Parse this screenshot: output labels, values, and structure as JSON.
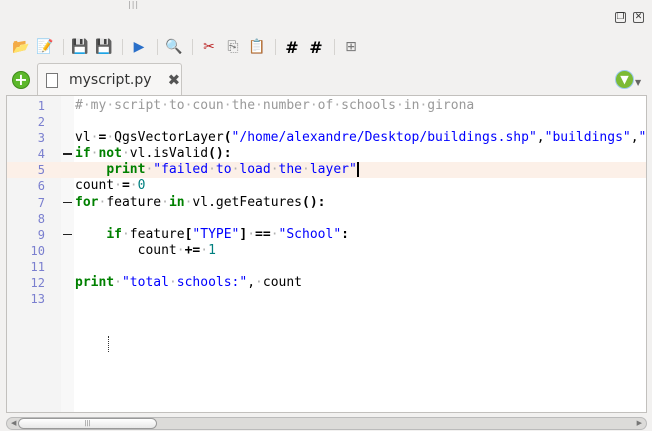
{
  "window": {
    "restore_icon": "restore-icon",
    "close_icon": "close-icon"
  },
  "toolbar": [
    {
      "name": "open-file-icon",
      "glyph": "📂"
    },
    {
      "name": "open-in-external-editor-icon",
      "glyph": "📝"
    },
    {
      "sep": true
    },
    {
      "name": "save-icon",
      "glyph": "💾"
    },
    {
      "name": "save-as-icon",
      "glyph": "💾"
    },
    {
      "sep": true
    },
    {
      "name": "run-script-icon",
      "glyph": "▶"
    },
    {
      "sep": true
    },
    {
      "name": "find-icon",
      "glyph": "🔍"
    },
    {
      "sep": true
    },
    {
      "name": "cut-icon",
      "glyph": "✂"
    },
    {
      "name": "copy-icon",
      "glyph": "⎘"
    },
    {
      "name": "paste-icon",
      "glyph": "📋"
    },
    {
      "sep": true
    },
    {
      "name": "comment-icon",
      "glyph": "#"
    },
    {
      "name": "uncomment-icon",
      "glyph": "#"
    },
    {
      "sep": true
    },
    {
      "name": "object-inspector-icon",
      "glyph": "⊞"
    }
  ],
  "tabs": [
    {
      "label": "myscript.py",
      "active": true
    }
  ],
  "editor": {
    "current_line": 5,
    "lines": [
      {
        "n": "1",
        "indent": 0,
        "fold": false,
        "tokens": [
          [
            "comment",
            "# my script to coun the number of schools in girona"
          ]
        ]
      },
      {
        "n": "2",
        "indent": 0,
        "fold": false,
        "tokens": []
      },
      {
        "n": "3",
        "indent": 0,
        "fold": false,
        "tokens": [
          [
            "id",
            "vl "
          ],
          [
            "op",
            "="
          ],
          [
            "id",
            " QgsVectorLayer"
          ],
          [
            "op",
            "("
          ],
          [
            "str",
            "\"/home/alexandre/Desktop/buildings.shp\""
          ],
          [
            "id",
            ","
          ],
          [
            "str",
            "\"buildings\""
          ],
          [
            "id",
            ","
          ],
          [
            "str",
            "\""
          ]
        ]
      },
      {
        "n": "4",
        "indent": 0,
        "fold": true,
        "tokens": [
          [
            "kw",
            "if"
          ],
          [
            "id",
            " "
          ],
          [
            "kw",
            "not"
          ],
          [
            "id",
            " vl.isValid"
          ],
          [
            "op",
            "():"
          ]
        ]
      },
      {
        "n": "5",
        "indent": 4,
        "fold": false,
        "tokens": [
          [
            "kw",
            "print"
          ],
          [
            "id",
            " "
          ],
          [
            "str",
            "\"failed to load the layer\""
          ]
        ]
      },
      {
        "n": "6",
        "indent": 0,
        "fold": false,
        "tokens": [
          [
            "id",
            "count "
          ],
          [
            "op",
            "="
          ],
          [
            "id",
            " "
          ],
          [
            "num",
            "0"
          ]
        ]
      },
      {
        "n": "7",
        "indent": 0,
        "fold": true,
        "tokens": [
          [
            "kw",
            "for"
          ],
          [
            "id",
            " feature "
          ],
          [
            "kw",
            "in"
          ],
          [
            "id",
            " vl.getFeatures"
          ],
          [
            "op",
            "():"
          ]
        ]
      },
      {
        "n": "8",
        "indent": 0,
        "fold": false,
        "tokens": []
      },
      {
        "n": "9",
        "indent": 4,
        "fold": true,
        "tokens": [
          [
            "kw",
            "if"
          ],
          [
            "id",
            " feature"
          ],
          [
            "op",
            "["
          ],
          [
            "str",
            "\"TYPE\""
          ],
          [
            "op",
            "]"
          ],
          [
            "id",
            " "
          ],
          [
            "op",
            "=="
          ],
          [
            "id",
            " "
          ],
          [
            "str",
            "\"School\""
          ],
          [
            "op",
            ":"
          ]
        ]
      },
      {
        "n": "10",
        "indent": 8,
        "fold": false,
        "tokens": [
          [
            "id",
            "count "
          ],
          [
            "op",
            "+="
          ],
          [
            "id",
            " "
          ],
          [
            "num",
            "1"
          ]
        ]
      },
      {
        "n": "11",
        "indent": 0,
        "fold": false,
        "tokens": []
      },
      {
        "n": "12",
        "indent": 0,
        "fold": false,
        "tokens": [
          [
            "kw",
            "print"
          ],
          [
            "id",
            " "
          ],
          [
            "str",
            "\"total schools:\""
          ],
          [
            "id",
            ", count"
          ]
        ]
      },
      {
        "n": "13",
        "indent": 0,
        "fold": false,
        "tokens": []
      }
    ]
  }
}
